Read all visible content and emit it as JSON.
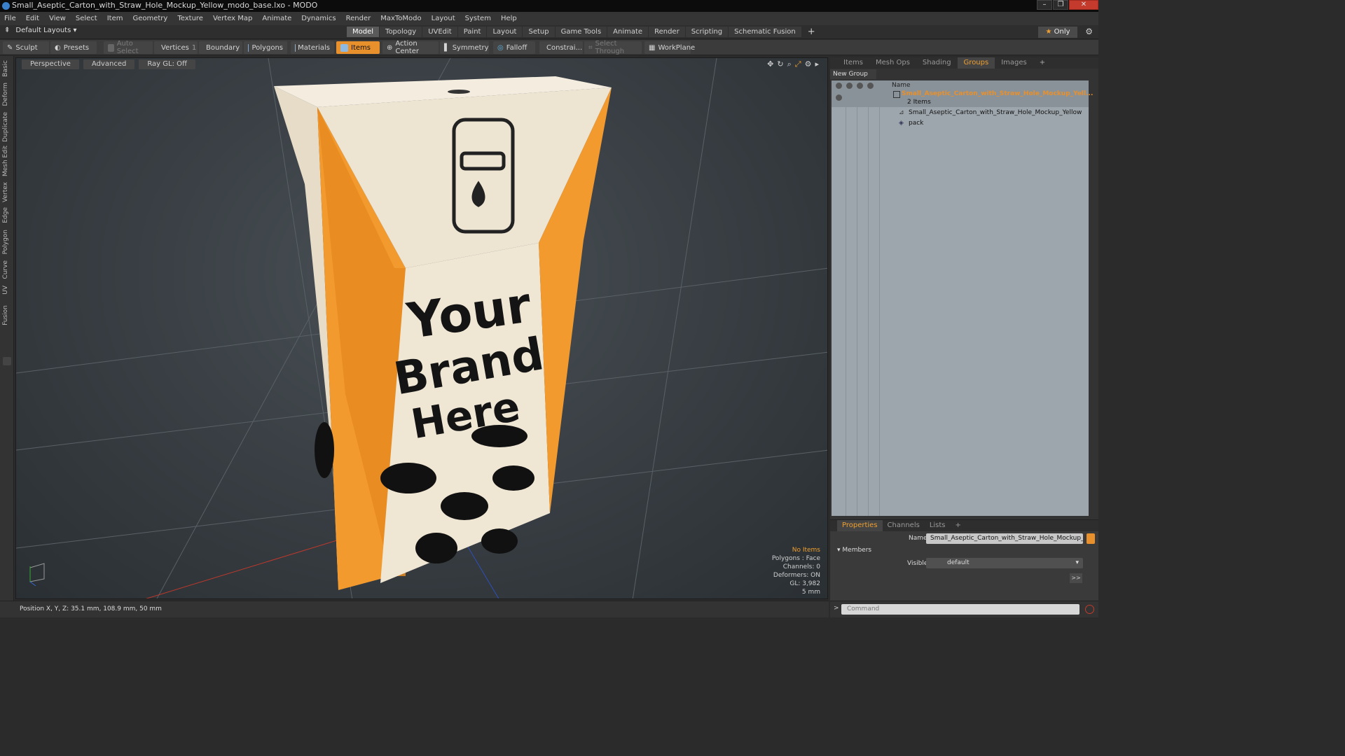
{
  "window": {
    "title": "Small_Aseptic_Carton_with_Straw_Hole_Mockup_Yellow_modo_base.lxo - MODO",
    "buttons": [
      "–",
      "❐",
      "✕"
    ]
  },
  "menu": [
    "File",
    "Edit",
    "View",
    "Select",
    "Item",
    "Geometry",
    "Texture",
    "Vertex Map",
    "Animate",
    "Dynamics",
    "Render",
    "MaxToModo",
    "Layout",
    "System",
    "Help"
  ],
  "layout_bar": {
    "layouts_label": "Default Layouts ▾",
    "tabs": [
      "Model",
      "Topology",
      "UVEdit",
      "Paint",
      "Layout",
      "Setup",
      "Game Tools",
      "Animate",
      "Render",
      "Scripting",
      "Schematic Fusion",
      "+"
    ],
    "active_tab": "Model",
    "only_label": "Only"
  },
  "toolbar": {
    "sculpt": "Sculpt",
    "presets": "Presets",
    "auto_select": "Auto Select",
    "vertices": "Vertices",
    "vertices_count": "1",
    "boundary": "Boundary",
    "polygons": "Polygons",
    "materials": "Materials",
    "items": "Items",
    "action_center": "Action Center",
    "symmetry": "Symmetry",
    "falloff": "Falloff",
    "constraints": "Constrai...",
    "select_through": "Select Through",
    "workplane": "WorkPlane"
  },
  "left_tabs": [
    "Basic",
    "Deform",
    "Duplicate",
    "Mesh Edit",
    "Vertex",
    "Edge",
    "Polygon",
    "Curve",
    "UV",
    "Fusion"
  ],
  "viewport": {
    "view": "Perspective",
    "shading": "Advanced",
    "raygl": "Ray GL: Off",
    "carton_text": [
      "Your",
      "Brand",
      "Here"
    ],
    "info": {
      "items": "No Items",
      "polygons": "Polygons : Face",
      "channels": "Channels: 0",
      "deformers": "Deformers: ON",
      "gl": "GL: 3,982",
      "scale": "5 mm"
    }
  },
  "status": {
    "position": "Position X, Y, Z:  35.1 mm, 108.9 mm, 50 mm"
  },
  "groups_panel": {
    "tabs": [
      "Items",
      "Mesh Ops",
      "Shading",
      "Groups",
      "Images",
      "+"
    ],
    "active_tab": "Groups",
    "new_group": "New Group",
    "col_name": "Name",
    "group_name": "Small_Aseptic_Carton_with_Straw_Hole_Mockup_Yell...",
    "group_count": "2 Items",
    "children": [
      "Small_Aseptic_Carton_with_Straw_Hole_Mockup_Yellow",
      "pack"
    ]
  },
  "properties_panel": {
    "tabs": [
      "Properties",
      "Channels",
      "Lists",
      "+"
    ],
    "active_tab": "Properties",
    "name_label": "Name",
    "name_value": "Small_Aseptic_Carton_with_Straw_Hole_Mockup_Yello",
    "members_label": "Members",
    "visible_label": "Visible",
    "visible_value": "default",
    "more_button": ">>"
  },
  "command": {
    "prompt": ">",
    "placeholder": "Command"
  },
  "colors": {
    "accent": "#e8902c",
    "carton_orange": "#f39a2e",
    "carton_cream": "#efe6d4"
  }
}
